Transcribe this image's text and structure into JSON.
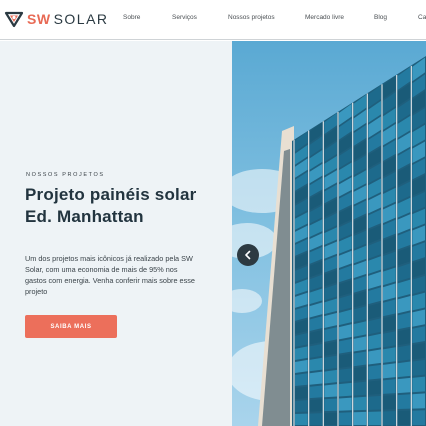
{
  "brand": {
    "name_part1": "SW",
    "name_part2": "SOLAR"
  },
  "nav": {
    "items": [
      {
        "label": "Sobre"
      },
      {
        "label": "Serviços"
      },
      {
        "label": "Nossos projetos"
      },
      {
        "label": "Mercado livre"
      },
      {
        "label": "Blog"
      },
      {
        "label": "Ca"
      }
    ]
  },
  "hero": {
    "kicker": "NOSSOS PROJETOS",
    "title": "Projeto painéis solar Ed. Manhattan",
    "description": "Um dos projetos mais icônicos já realizado pela SW Solar, com uma economia de mais de 95% nos gastos com energia. Venha conferir mais sobre esse projeto",
    "cta_label": "SAIBA MAIS",
    "image_icon": "building-solar-facade-photo",
    "prev_icon": "chevron-left-icon"
  },
  "colors": {
    "accent": "#ec6f5b",
    "dark": "#22343f",
    "panel_bg": "#eef3f6"
  }
}
